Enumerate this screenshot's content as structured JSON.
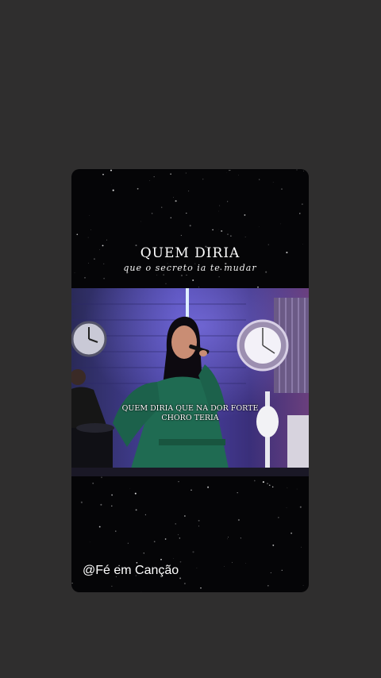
{
  "story": {
    "title": "QUEM DIRIA",
    "subtitle": "que o secreto ia te mudar",
    "video_lyric_line1": "QUEM DIRIA QUE NA DOR FORTE",
    "video_lyric_line2": "CHORO TERIA",
    "watermark": "@Fé em Canção"
  },
  "colors": {
    "background": "#2f2e2e",
    "card": "#050507",
    "stage_light": "#5a4fd6",
    "dress": "#1f6b52"
  }
}
